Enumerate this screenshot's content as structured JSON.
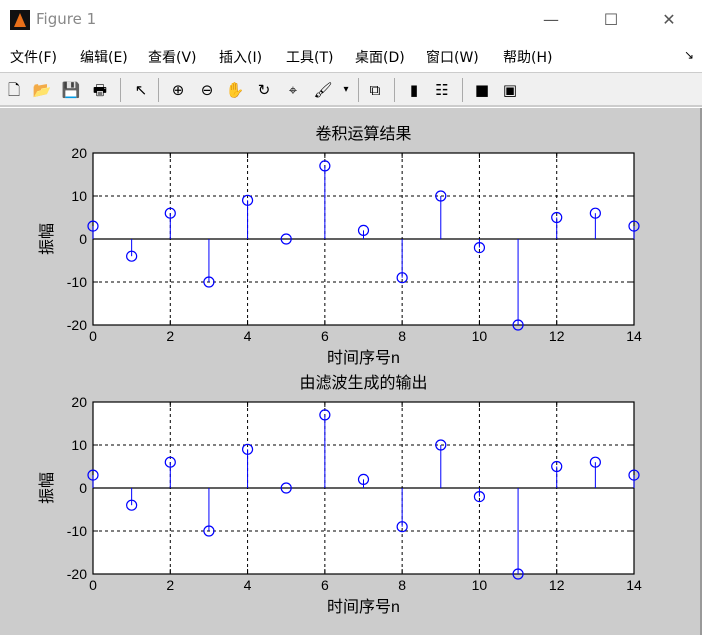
{
  "window": {
    "title": "Figure 1",
    "minimize": "—",
    "maximize": "☐",
    "close": "✕"
  },
  "menu": [
    "文件(F)",
    "编辑(E)",
    "查看(V)",
    "插入(I)",
    "工具(T)",
    "桌面(D)",
    "窗口(W)",
    "帮助(H)"
  ],
  "menu_arrow": "↘",
  "toolbar": [
    {
      "name": "new-figure-icon",
      "glyph": "🗋"
    },
    {
      "name": "open-icon",
      "glyph": "📂"
    },
    {
      "name": "save-icon",
      "glyph": "💾"
    },
    {
      "name": "print-icon",
      "glyph": "🖶"
    },
    {
      "name": "pointer-icon",
      "glyph": "↖"
    },
    {
      "name": "zoom-in-icon",
      "glyph": "⊕"
    },
    {
      "name": "zoom-out-icon",
      "glyph": "⊖"
    },
    {
      "name": "pan-icon",
      "glyph": "✋"
    },
    {
      "name": "rotate-icon",
      "glyph": "↻"
    },
    {
      "name": "data-cursor-icon",
      "glyph": "⌖"
    },
    {
      "name": "brush-icon",
      "glyph": "🖌"
    },
    {
      "name": "brush-dropdown-icon",
      "glyph": "▾"
    },
    {
      "name": "link-plot-icon",
      "glyph": "⧉"
    },
    {
      "name": "colorbar-icon",
      "glyph": "▮"
    },
    {
      "name": "legend-icon",
      "glyph": "☷"
    },
    {
      "name": "hide-plot-tools-icon",
      "glyph": "■"
    },
    {
      "name": "show-plot-tools-icon",
      "glyph": "▣"
    }
  ],
  "colors": {
    "stem": "#0000ff",
    "grid": "#000000"
  },
  "chart_data": [
    {
      "type": "stem",
      "title": "卷积运算结果",
      "xlabel": "时间序号n",
      "ylabel": "振幅",
      "x": [
        0,
        1,
        2,
        3,
        4,
        5,
        6,
        7,
        8,
        9,
        10,
        11,
        12,
        13,
        14
      ],
      "values": [
        3,
        -4,
        6,
        -10,
        9,
        0,
        17,
        2,
        -9,
        10,
        -2,
        -20,
        5,
        6,
        3
      ],
      "xlim": [
        0,
        14
      ],
      "ylim": [
        -20,
        20
      ],
      "xticks": [
        "0",
        "2",
        "4",
        "6",
        "8",
        "10",
        "12",
        "14"
      ],
      "yticks": [
        "-20",
        "-10",
        "0",
        "10",
        "20"
      ],
      "grid": true
    },
    {
      "type": "stem",
      "title": "由滤波生成的输出",
      "xlabel": "时间序号n",
      "ylabel": "振幅",
      "x": [
        0,
        1,
        2,
        3,
        4,
        5,
        6,
        7,
        8,
        9,
        10,
        11,
        12,
        13,
        14
      ],
      "values": [
        3,
        -4,
        6,
        -10,
        9,
        0,
        17,
        2,
        -9,
        10,
        -2,
        -20,
        5,
        6,
        3
      ],
      "xlim": [
        0,
        14
      ],
      "ylim": [
        -20,
        20
      ],
      "xticks": [
        "0",
        "2",
        "4",
        "6",
        "8",
        "10",
        "12",
        "14"
      ],
      "yticks": [
        "-20",
        "-10",
        "0",
        "10",
        "20"
      ],
      "grid": true
    }
  ]
}
